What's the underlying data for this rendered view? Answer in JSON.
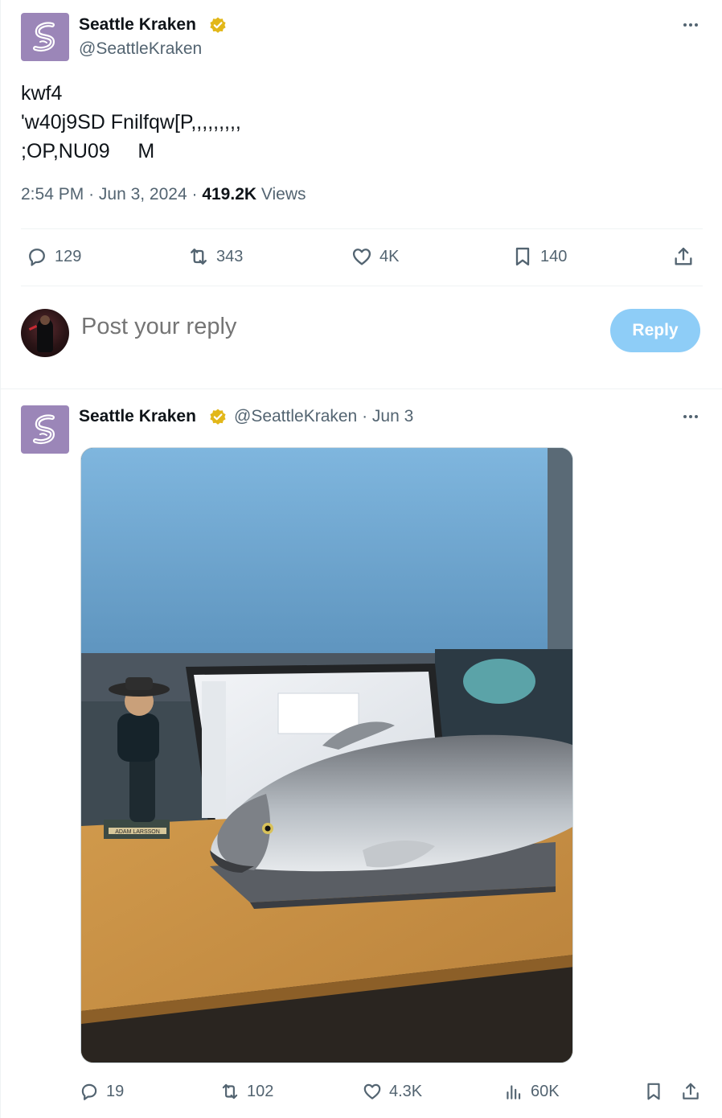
{
  "main_tweet": {
    "author_name": "Seattle Kraken",
    "author_handle": "@SeattleKraken",
    "text": "kwf4\n'w40j9SD Fnilfqw[P,,,,,,,,,\n;OP,NU09     M",
    "time": "2:54 PM",
    "date": "Jun 3, 2024",
    "views_count": "419.2K",
    "views_label": "Views",
    "actions": {
      "replies": "129",
      "reposts": "343",
      "likes": "4K",
      "bookmarks": "140"
    }
  },
  "reply_box": {
    "placeholder": "Post your reply",
    "button_label": "Reply"
  },
  "second_tweet": {
    "author_name": "Seattle Kraken",
    "header_rest": "@SeattleKraken · Jun 3",
    "media_bobblehead_label": "ADAM LARSSON",
    "actions": {
      "replies": "19",
      "reposts": "102",
      "likes": "4.3K",
      "views": "60K"
    }
  },
  "colors": {
    "text_primary": "#0f1419",
    "text_secondary": "#536471",
    "verified_gold": "#e2b719",
    "reply_button_bg": "#8ecdf7",
    "avatar_bg": "#9b86b8",
    "divider": "#eff3f4"
  },
  "icons": {
    "reply": "speech-bubble-icon",
    "repost": "repost-arrows-icon",
    "like": "heart-icon",
    "bookmark": "bookmark-icon",
    "share": "share-upload-icon",
    "views": "bar-chart-icon",
    "verified": "gold-verified-badge-icon",
    "more": "more-dots-icon"
  }
}
